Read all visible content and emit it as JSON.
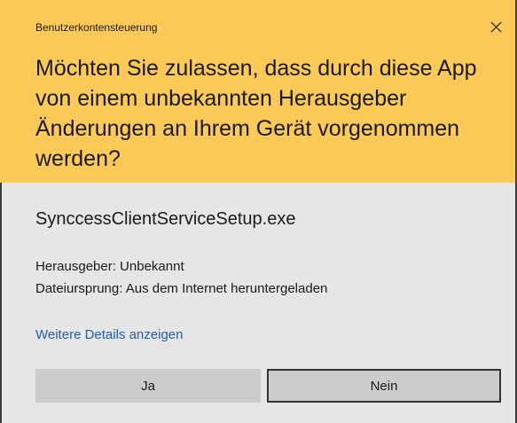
{
  "window": {
    "title": "Benutzerkontensteuerung",
    "close_icon": "close-icon",
    "header_color": "#fdc957",
    "body_color": "#e6e6e6"
  },
  "prompt": {
    "question": "Möchten Sie zulassen, dass durch diese App von einem unbekannten Herausgeber Änderungen an Ihrem Gerät vorgenommen werden?"
  },
  "app": {
    "name": "SynccessClientServiceSetup.exe",
    "publisher": "Herausgeber: Unbekannt",
    "origin": "Dateiursprung: Aus dem Internet heruntergeladen"
  },
  "links": {
    "details": "Weitere Details anzeigen",
    "link_color": "#1f5ea8"
  },
  "buttons": {
    "yes": "Ja",
    "no": "Nein"
  }
}
